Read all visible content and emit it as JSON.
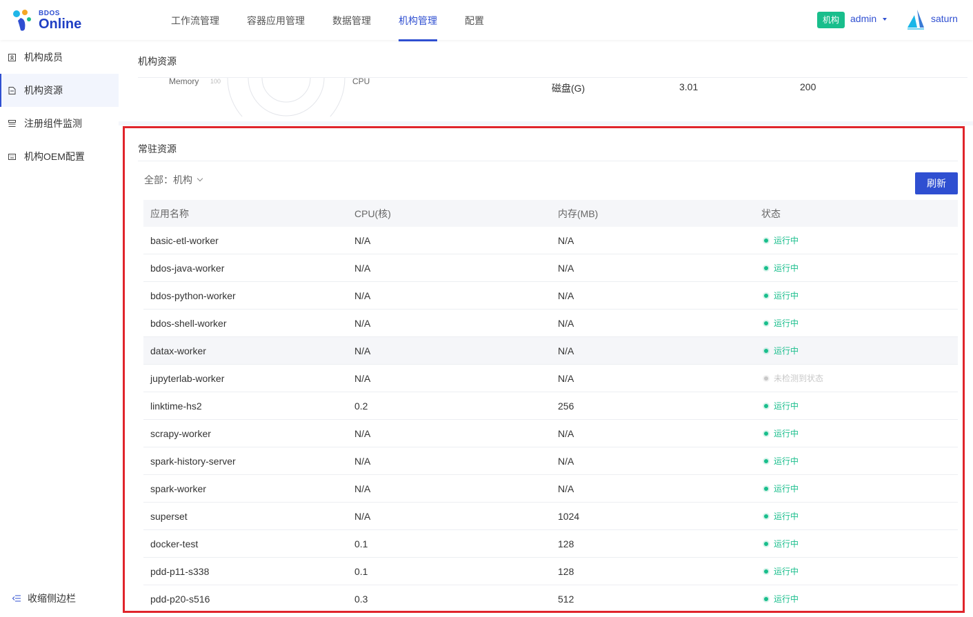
{
  "header": {
    "logo_small": "BDOS",
    "logo_big": "Online",
    "nav": [
      "工作流管理",
      "容器应用管理",
      "数据管理",
      "机构管理",
      "配置"
    ],
    "active_nav": 3,
    "org_tag": "机构",
    "user": "admin",
    "project": "saturn"
  },
  "sidebar": {
    "items": [
      {
        "label": "机构成员",
        "icon": "user-card-icon"
      },
      {
        "label": "机构资源",
        "icon": "document-icon"
      },
      {
        "label": "注册组件监测",
        "icon": "list-icon"
      },
      {
        "label": "机构OEM配置",
        "icon": "keyboard-icon"
      }
    ],
    "active": 1,
    "collapse_label": "收缩侧边栏"
  },
  "org_resources": {
    "title": "机构资源",
    "memory_label": "Memory",
    "memory_tick": "100",
    "cpu_label": "CPU",
    "disk_label": "磁盘(G)",
    "disk_used": "3.01",
    "disk_total": "200"
  },
  "resident": {
    "title": "常驻资源",
    "filter_label": "全部：机构",
    "refresh_label": "刷新",
    "columns": [
      "应用名称",
      "CPU(核)",
      "内存(MB)",
      "状态"
    ],
    "rows": [
      {
        "name": "basic-etl-worker",
        "cpu": "N/A",
        "mem": "N/A",
        "status": "运行中",
        "running": true
      },
      {
        "name": "bdos-java-worker",
        "cpu": "N/A",
        "mem": "N/A",
        "status": "运行中",
        "running": true
      },
      {
        "name": "bdos-python-worker",
        "cpu": "N/A",
        "mem": "N/A",
        "status": "运行中",
        "running": true
      },
      {
        "name": "bdos-shell-worker",
        "cpu": "N/A",
        "mem": "N/A",
        "status": "运行中",
        "running": true
      },
      {
        "name": "datax-worker",
        "cpu": "N/A",
        "mem": "N/A",
        "status": "运行中",
        "running": true
      },
      {
        "name": "jupyterlab-worker",
        "cpu": "N/A",
        "mem": "N/A",
        "status": "未检测到状态",
        "running": false
      },
      {
        "name": "linktime-hs2",
        "cpu": "0.2",
        "mem": "256",
        "status": "运行中",
        "running": true
      },
      {
        "name": "scrapy-worker",
        "cpu": "N/A",
        "mem": "N/A",
        "status": "运行中",
        "running": true
      },
      {
        "name": "spark-history-server",
        "cpu": "N/A",
        "mem": "N/A",
        "status": "运行中",
        "running": true
      },
      {
        "name": "spark-worker",
        "cpu": "N/A",
        "mem": "N/A",
        "status": "运行中",
        "running": true
      },
      {
        "name": "superset",
        "cpu": "N/A",
        "mem": "1024",
        "status": "运行中",
        "running": true
      },
      {
        "name": "docker-test",
        "cpu": "0.1",
        "mem": "128",
        "status": "运行中",
        "running": true
      },
      {
        "name": "pdd-p11-s338",
        "cpu": "0.1",
        "mem": "128",
        "status": "运行中",
        "running": true
      },
      {
        "name": "pdd-p20-s516",
        "cpu": "0.3",
        "mem": "512",
        "status": "运行中",
        "running": true
      }
    ],
    "hover_row": 4
  },
  "colors": {
    "accent": "#2f4fd1",
    "running": "#19be8c",
    "unknown": "#c8c8c8",
    "highlight": "#e0242b"
  }
}
